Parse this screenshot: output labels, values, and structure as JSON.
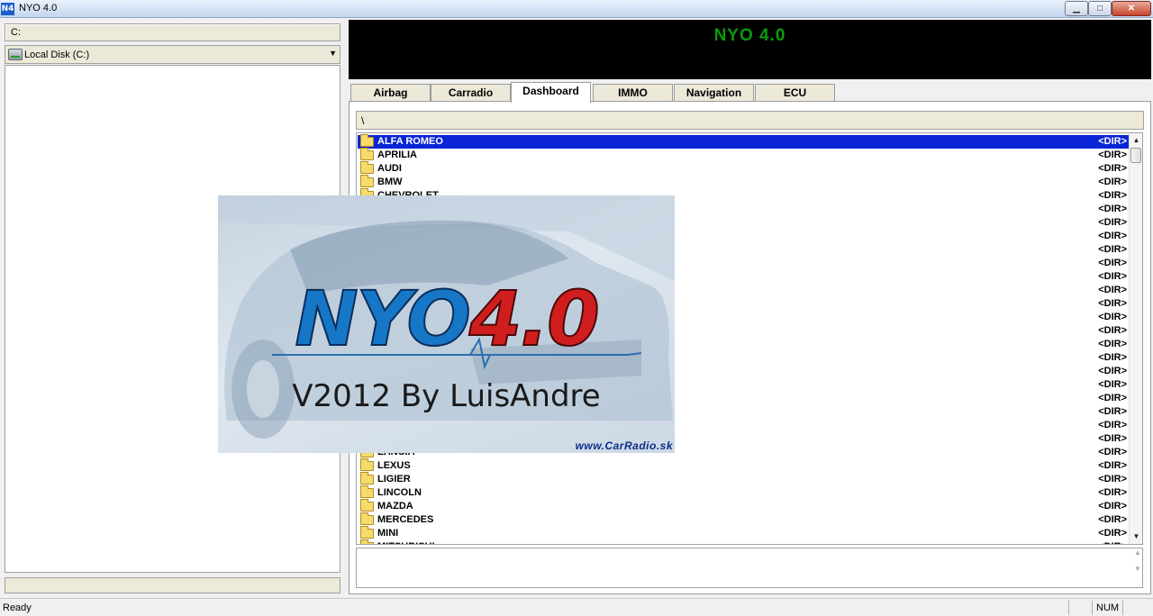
{
  "window": {
    "app_icon_text": "N4",
    "title": "NYO 4.0"
  },
  "left_panel": {
    "path": "C:",
    "drive": "Local Disk (C:)"
  },
  "banner": {
    "title": "NYO 4.0"
  },
  "tabs": [
    {
      "label": "Airbag",
      "active": false
    },
    {
      "label": "Carradio",
      "active": false
    },
    {
      "label": "Dashboard",
      "active": true
    },
    {
      "label": "IMMO",
      "active": false
    },
    {
      "label": "Navigation",
      "active": false
    },
    {
      "label": "ECU",
      "active": false
    }
  ],
  "directory": {
    "path": "\\",
    "dir_tag": "<DIR>",
    "rows": [
      {
        "name": "ALFA ROMEO",
        "selected": true
      },
      {
        "name": "APRILIA"
      },
      {
        "name": "AUDI"
      },
      {
        "name": "BMW"
      },
      {
        "name": "CHEVROLET"
      },
      {
        "name": ""
      },
      {
        "name": ""
      },
      {
        "name": ""
      },
      {
        "name": ""
      },
      {
        "name": ""
      },
      {
        "name": ""
      },
      {
        "name": ""
      },
      {
        "name": ""
      },
      {
        "name": ""
      },
      {
        "name": ""
      },
      {
        "name": ""
      },
      {
        "name": ""
      },
      {
        "name": ""
      },
      {
        "name": ""
      },
      {
        "name": ""
      },
      {
        "name": ""
      },
      {
        "name": ""
      },
      {
        "name": ""
      },
      {
        "name": "LANCIA"
      },
      {
        "name": "LEXUS"
      },
      {
        "name": "LIGIER"
      },
      {
        "name": "LINCOLN"
      },
      {
        "name": "MAZDA"
      },
      {
        "name": "MERCEDES"
      },
      {
        "name": "MINI"
      },
      {
        "name": "MITSUBISHI"
      }
    ]
  },
  "statusbar": {
    "text": "Ready",
    "num": "NUM"
  },
  "splash": {
    "logo_part1": "NYO",
    "logo_part2": "4.0",
    "subtitle": "V2012 By LuisAndre",
    "url": "www.CarRadio.sk"
  },
  "colors": {
    "selection": "#0a24d6",
    "banner_text": "#0b9b0b",
    "logo_blue": "#1577c6",
    "logo_red": "#d01e1e"
  },
  "icons": {
    "folder": "folder-icon",
    "drive": "hard-drive-icon"
  }
}
